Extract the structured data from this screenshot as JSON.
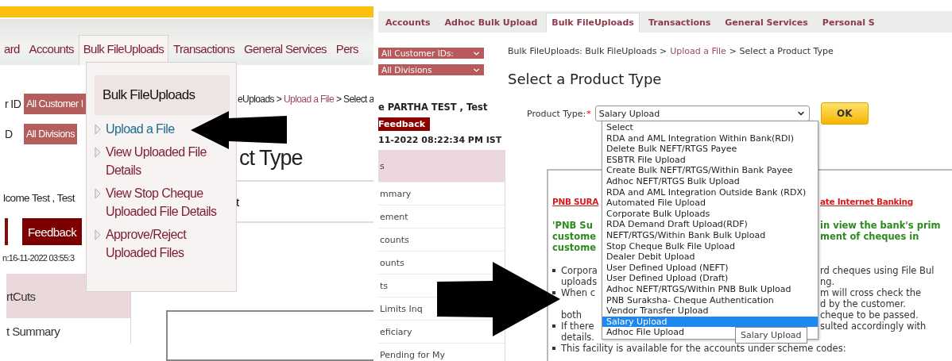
{
  "left_screenshot": {
    "tabs": [
      {
        "label": "ard",
        "selected": false
      },
      {
        "label": "Accounts",
        "selected": false
      },
      {
        "label": "Bulk FileUploads",
        "selected": true
      },
      {
        "label": "Transactions",
        "selected": false
      },
      {
        "label": "General Services",
        "selected": false
      },
      {
        "label": "Pers",
        "selected": false
      }
    ],
    "filters": [
      {
        "label": "r ID",
        "value": "All Customer I"
      },
      {
        "label": "D",
        "value": "All Divisions"
      }
    ],
    "welcome": "lcome Test , Test",
    "feedback": "Feedback",
    "last_login": "n:16-11-2022 03:55:3",
    "sidebar": [
      {
        "label": "rtCuts",
        "selected": true
      },
      {
        "label": "t Summary",
        "selected": false
      }
    ],
    "breadcrumb": [
      {
        "kind": "text",
        "text": "eUploads >"
      },
      {
        "kind": "link",
        "text": "Upload a File"
      },
      {
        "kind": "text",
        "text": "> Select a"
      }
    ],
    "heading": "ct Type",
    "panel_text": "t",
    "menu": {
      "title": "Bulk FileUploads",
      "items": [
        {
          "label": "Upload a File",
          "selected": true
        },
        {
          "label": "View Uploaded File Details",
          "selected": false
        },
        {
          "label": "View Stop Cheque Uploaded File Details",
          "selected": false
        },
        {
          "label": "Approve/Reject Uploaded Files",
          "selected": false
        }
      ]
    }
  },
  "right_screenshot": {
    "tabs": [
      {
        "label": "Accounts",
        "selected": false
      },
      {
        "label": "Adhoc Bulk Upload",
        "selected": false
      },
      {
        "label": "Bulk FileUploads",
        "selected": true
      },
      {
        "label": "Transactions",
        "selected": false
      },
      {
        "label": "General Services",
        "selected": false
      },
      {
        "label": "Personal S",
        "selected": false
      }
    ],
    "filters": [
      "All Customer IDs:",
      "All Divisions"
    ],
    "welcome": "e PARTHA TEST , Test",
    "feedback": "Feedback",
    "last_login": "11-2022 08:22:34 PM IST",
    "sidebar": [
      {
        "label": "s",
        "selected": true
      },
      {
        "label": "mmary",
        "selected": false
      },
      {
        "label": "ement",
        "selected": false
      },
      {
        "label": "counts",
        "selected": false
      },
      {
        "label": "ounts",
        "selected": false
      },
      {
        "label": "ts",
        "selected": false
      },
      {
        "label": "Limits Inq",
        "selected": false
      },
      {
        "label": "eficiary",
        "selected": false
      },
      {
        "label": "Pending for My",
        "selected": false
      }
    ],
    "breadcrumb": [
      {
        "kind": "text",
        "text": "Bulk FileUploads: Bulk FileUploads >"
      },
      {
        "kind": "link",
        "text": "Upload a File"
      },
      {
        "kind": "text",
        "text": "> Select a Product Type"
      }
    ],
    "heading": "Select a Product Type",
    "product_type": {
      "label": "Product Type:",
      "required_mark": "*",
      "value": "Salary Upload"
    },
    "ok_button": "OK",
    "options": [
      {
        "label": "Select",
        "selected": false
      },
      {
        "label": "RDA and AML Integration Within Bank(RDI)",
        "selected": false
      },
      {
        "label": "Delete Bulk NEFT/RTGS Payee",
        "selected": false
      },
      {
        "label": "ESBTR File Upload",
        "selected": false
      },
      {
        "label": "Create Bulk NEFT/RTGS/Within Bank Payee",
        "selected": false
      },
      {
        "label": "Adhoc NEFT/RTGS Bulk Upload",
        "selected": false
      },
      {
        "label": "RDA and AML Integration Outside Bank (RDX)",
        "selected": false
      },
      {
        "label": "Automated File Upload",
        "selected": false
      },
      {
        "label": "Corporate Bulk Uploads",
        "selected": false
      },
      {
        "label": "RDA Demand Draft Upload(RDF)",
        "selected": false
      },
      {
        "label": "NEFT/RTGS/Within Bank Bulk Upload",
        "selected": false
      },
      {
        "label": "Stop Cheque Bulk File Upload",
        "selected": false
      },
      {
        "label": "Dealer Debit Upload",
        "selected": false
      },
      {
        "label": "User Defined Upload (NEFT)",
        "selected": false
      },
      {
        "label": "User Defined Upload (Draft)",
        "selected": false
      },
      {
        "label": "Adhoc NEFT/RTGS/Within PNB Bulk Upload",
        "selected": false
      },
      {
        "label": "PNB Suraksha- Cheque Authentication",
        "selected": false
      },
      {
        "label": "Vendor Transfer Upload",
        "selected": false
      },
      {
        "label": "Salary Upload",
        "selected": true
      },
      {
        "label": "Adhoc File Upload",
        "selected": false
      }
    ],
    "tooltip": "Salary Upload",
    "content_lines": [
      {
        "kind": "title",
        "left": "PNB SURA",
        "right": "ate Internet Banking"
      },
      {
        "kind": "notice",
        "left": "'PNB Su",
        "right": "in view the bank's prim"
      },
      {
        "kind": "notice",
        "left": "custome",
        "right": "ment of cheques in"
      },
      {
        "kind": "notice",
        "left": "custome"
      },
      {
        "kind": "bullet",
        "left": "Corpora",
        "right": "rd cheques using File Bul"
      },
      {
        "kind": "text",
        "left": "uploads",
        "right": "ng."
      },
      {
        "kind": "bullet",
        "left": "When c",
        "right": "m will cross check the"
      },
      {
        "kind": "text",
        "right": "d by the customer."
      },
      {
        "kind": "text",
        "left": "both",
        "right": "cheque to be passed."
      },
      {
        "kind": "bullet",
        "left": "If there",
        "right": "sulted accordingly with"
      },
      {
        "kind": "text",
        "left": "details."
      },
      {
        "kind": "bullet",
        "full": "This facility is available for the accounts under scheme codes:"
      }
    ]
  }
}
